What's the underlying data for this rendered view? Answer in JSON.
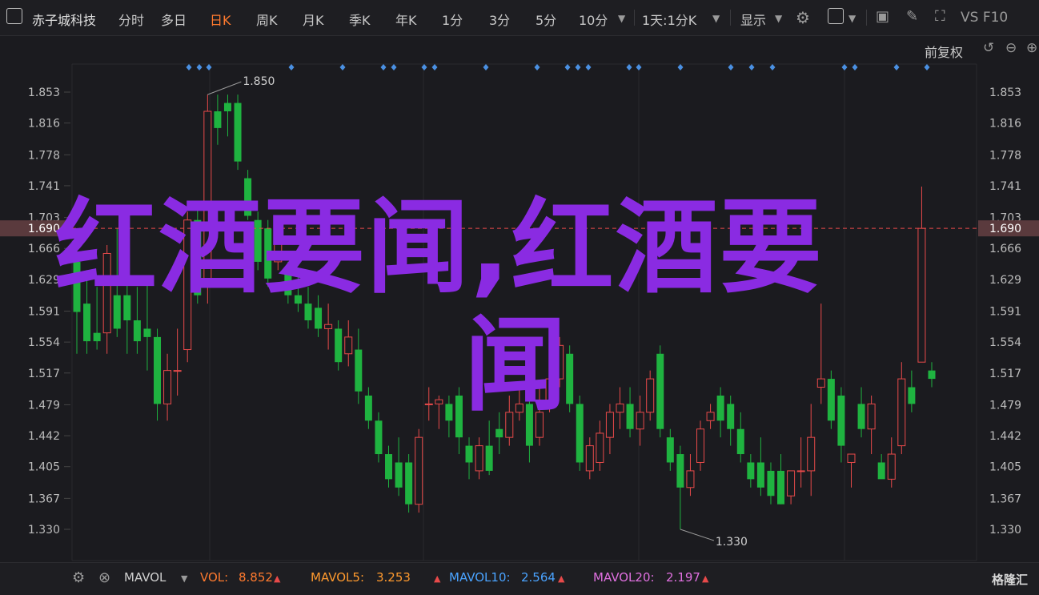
{
  "toolbar": {
    "stock_name": "赤子城科技",
    "periods": [
      "分时",
      "多日",
      "日K",
      "周K",
      "月K",
      "季K",
      "年K",
      "1分",
      "3分",
      "5分",
      "10分"
    ],
    "active_period": "日K",
    "range": "1天:1分K",
    "display": "显示",
    "vs_label": "VS F10"
  },
  "subbar": {
    "adjust": "前复权"
  },
  "watermark": {
    "line1": "红酒要闻,红酒要",
    "line2": "闻"
  },
  "colors": {
    "up": "#e84a4a",
    "down": "#1fb340",
    "watermark": "#8a2be2",
    "marker": "#4a90e2",
    "bg": "#1b1b1f"
  },
  "chart_data": {
    "type": "candlestick",
    "y_ticks": [
      "1.853",
      "1.816",
      "1.778",
      "1.741",
      "1.703",
      "1.666",
      "1.629",
      "1.591",
      "1.554",
      "1.517",
      "1.479",
      "1.442",
      "1.405",
      "1.367",
      "1.330"
    ],
    "ylim": [
      1.33,
      1.853
    ],
    "current_price": "1.690",
    "high_annotation": "1.850",
    "low_annotation": "1.330",
    "candles": [
      {
        "o": 1.65,
        "h": 1.68,
        "l": 1.54,
        "c": 1.59
      },
      {
        "o": 1.6,
        "h": 1.64,
        "l": 1.54,
        "c": 1.555
      },
      {
        "o": 1.565,
        "h": 1.62,
        "l": 1.545,
        "c": 1.555
      },
      {
        "o": 1.565,
        "h": 1.67,
        "l": 1.54,
        "c": 1.66
      },
      {
        "o": 1.61,
        "h": 1.69,
        "l": 1.56,
        "c": 1.57
      },
      {
        "o": 1.61,
        "h": 1.65,
        "l": 1.54,
        "c": 1.58
      },
      {
        "o": 1.58,
        "h": 1.62,
        "l": 1.54,
        "c": 1.555
      },
      {
        "o": 1.57,
        "h": 1.63,
        "l": 1.52,
        "c": 1.56
      },
      {
        "o": 1.56,
        "h": 1.57,
        "l": 1.46,
        "c": 1.48
      },
      {
        "o": 1.48,
        "h": 1.54,
        "l": 1.46,
        "c": 1.52
      },
      {
        "o": 1.52,
        "h": 1.57,
        "l": 1.49,
        "c": 1.52
      },
      {
        "o": 1.545,
        "h": 1.71,
        "l": 1.53,
        "c": 1.7
      },
      {
        "o": 1.7,
        "h": 1.72,
        "l": 1.6,
        "c": 1.61
      },
      {
        "o": 1.63,
        "h": 1.85,
        "l": 1.6,
        "c": 1.83
      },
      {
        "o": 1.83,
        "h": 1.85,
        "l": 1.79,
        "c": 1.81
      },
      {
        "o": 1.84,
        "h": 1.85,
        "l": 1.8,
        "c": 1.83
      },
      {
        "o": 1.84,
        "h": 1.85,
        "l": 1.76,
        "c": 1.77
      },
      {
        "o": 1.75,
        "h": 1.76,
        "l": 1.7,
        "c": 1.705
      },
      {
        "o": 1.7,
        "h": 1.71,
        "l": 1.64,
        "c": 1.65
      },
      {
        "o": 1.69,
        "h": 1.7,
        "l": 1.62,
        "c": 1.63
      },
      {
        "o": 1.65,
        "h": 1.7,
        "l": 1.64,
        "c": 1.69
      },
      {
        "o": 1.64,
        "h": 1.65,
        "l": 1.6,
        "c": 1.61
      },
      {
        "o": 1.61,
        "h": 1.64,
        "l": 1.59,
        "c": 1.6
      },
      {
        "o": 1.6,
        "h": 1.62,
        "l": 1.57,
        "c": 1.58
      },
      {
        "o": 1.595,
        "h": 1.61,
        "l": 1.56,
        "c": 1.57
      },
      {
        "o": 1.57,
        "h": 1.6,
        "l": 1.545,
        "c": 1.575
      },
      {
        "o": 1.57,
        "h": 1.58,
        "l": 1.52,
        "c": 1.53
      },
      {
        "o": 1.54,
        "h": 1.58,
        "l": 1.525,
        "c": 1.56
      },
      {
        "o": 1.545,
        "h": 1.57,
        "l": 1.48,
        "c": 1.495
      },
      {
        "o": 1.49,
        "h": 1.5,
        "l": 1.45,
        "c": 1.46
      },
      {
        "o": 1.46,
        "h": 1.47,
        "l": 1.41,
        "c": 1.42
      },
      {
        "o": 1.42,
        "h": 1.43,
        "l": 1.38,
        "c": 1.39
      },
      {
        "o": 1.41,
        "h": 1.44,
        "l": 1.37,
        "c": 1.38
      },
      {
        "o": 1.41,
        "h": 1.42,
        "l": 1.35,
        "c": 1.36
      },
      {
        "o": 1.36,
        "h": 1.45,
        "l": 1.35,
        "c": 1.44
      },
      {
        "o": 1.48,
        "h": 1.5,
        "l": 1.46,
        "c": 1.48
      },
      {
        "o": 1.48,
        "h": 1.49,
        "l": 1.45,
        "c": 1.485
      },
      {
        "o": 1.48,
        "h": 1.49,
        "l": 1.44,
        "c": 1.46
      },
      {
        "o": 1.49,
        "h": 1.5,
        "l": 1.42,
        "c": 1.44
      },
      {
        "o": 1.43,
        "h": 1.44,
        "l": 1.39,
        "c": 1.41
      },
      {
        "o": 1.4,
        "h": 1.44,
        "l": 1.39,
        "c": 1.43
      },
      {
        "o": 1.43,
        "h": 1.46,
        "l": 1.395,
        "c": 1.4
      },
      {
        "o": 1.45,
        "h": 1.47,
        "l": 1.42,
        "c": 1.44
      },
      {
        "o": 1.44,
        "h": 1.49,
        "l": 1.43,
        "c": 1.47
      },
      {
        "o": 1.47,
        "h": 1.5,
        "l": 1.46,
        "c": 1.48
      },
      {
        "o": 1.48,
        "h": 1.5,
        "l": 1.41,
        "c": 1.43
      },
      {
        "o": 1.44,
        "h": 1.5,
        "l": 1.43,
        "c": 1.47
      },
      {
        "o": 1.48,
        "h": 1.54,
        "l": 1.47,
        "c": 1.51
      },
      {
        "o": 1.51,
        "h": 1.56,
        "l": 1.5,
        "c": 1.55
      },
      {
        "o": 1.54,
        "h": 1.55,
        "l": 1.47,
        "c": 1.48
      },
      {
        "o": 1.48,
        "h": 1.49,
        "l": 1.4,
        "c": 1.41
      },
      {
        "o": 1.4,
        "h": 1.44,
        "l": 1.39,
        "c": 1.43
      },
      {
        "o": 1.41,
        "h": 1.46,
        "l": 1.4,
        "c": 1.445
      },
      {
        "o": 1.44,
        "h": 1.48,
        "l": 1.42,
        "c": 1.47
      },
      {
        "o": 1.47,
        "h": 1.5,
        "l": 1.45,
        "c": 1.48
      },
      {
        "o": 1.48,
        "h": 1.5,
        "l": 1.44,
        "c": 1.45
      },
      {
        "o": 1.45,
        "h": 1.49,
        "l": 1.43,
        "c": 1.47
      },
      {
        "o": 1.47,
        "h": 1.52,
        "l": 1.46,
        "c": 1.51
      },
      {
        "o": 1.54,
        "h": 1.55,
        "l": 1.44,
        "c": 1.45
      },
      {
        "o": 1.44,
        "h": 1.45,
        "l": 1.4,
        "c": 1.41
      },
      {
        "o": 1.42,
        "h": 1.43,
        "l": 1.33,
        "c": 1.38
      },
      {
        "o": 1.38,
        "h": 1.42,
        "l": 1.37,
        "c": 1.4
      },
      {
        "o": 1.41,
        "h": 1.46,
        "l": 1.4,
        "c": 1.45
      },
      {
        "o": 1.46,
        "h": 1.48,
        "l": 1.45,
        "c": 1.47
      },
      {
        "o": 1.49,
        "h": 1.5,
        "l": 1.44,
        "c": 1.46
      },
      {
        "o": 1.48,
        "h": 1.49,
        "l": 1.43,
        "c": 1.45
      },
      {
        "o": 1.45,
        "h": 1.47,
        "l": 1.41,
        "c": 1.42
      },
      {
        "o": 1.41,
        "h": 1.42,
        "l": 1.38,
        "c": 1.39
      },
      {
        "o": 1.41,
        "h": 1.44,
        "l": 1.37,
        "c": 1.38
      },
      {
        "o": 1.4,
        "h": 1.41,
        "l": 1.36,
        "c": 1.37
      },
      {
        "o": 1.4,
        "h": 1.42,
        "l": 1.36,
        "c": 1.36
      },
      {
        "o": 1.37,
        "h": 1.4,
        "l": 1.36,
        "c": 1.4
      },
      {
        "o": 1.4,
        "h": 1.44,
        "l": 1.38,
        "c": 1.4
      },
      {
        "o": 1.4,
        "h": 1.48,
        "l": 1.37,
        "c": 1.44
      },
      {
        "o": 1.5,
        "h": 1.6,
        "l": 1.48,
        "c": 1.51
      },
      {
        "o": 1.51,
        "h": 1.52,
        "l": 1.45,
        "c": 1.46
      },
      {
        "o": 1.49,
        "h": 1.5,
        "l": 1.41,
        "c": 1.43
      },
      {
        "o": 1.41,
        "h": 1.42,
        "l": 1.38,
        "c": 1.42
      },
      {
        "o": 1.48,
        "h": 1.5,
        "l": 1.44,
        "c": 1.45
      },
      {
        "o": 1.45,
        "h": 1.49,
        "l": 1.42,
        "c": 1.48
      },
      {
        "o": 1.41,
        "h": 1.42,
        "l": 1.4,
        "c": 1.39
      },
      {
        "o": 1.39,
        "h": 1.44,
        "l": 1.38,
        "c": 1.42
      },
      {
        "o": 1.43,
        "h": 1.53,
        "l": 1.42,
        "c": 1.51
      },
      {
        "o": 1.5,
        "h": 1.52,
        "l": 1.47,
        "c": 1.48
      },
      {
        "o": 1.53,
        "h": 1.74,
        "l": 1.53,
        "c": 1.69
      },
      {
        "o": 1.52,
        "h": 1.53,
        "l": 1.5,
        "c": 1.51
      }
    ]
  },
  "markers": [
    236,
    249,
    261,
    364,
    428,
    479,
    492,
    530,
    543,
    607,
    671,
    709,
    722,
    735,
    786,
    798,
    850,
    913,
    939,
    965,
    1055,
    1068,
    1120,
    1158
  ],
  "volume_bar": {
    "indicator": "MAVOL",
    "vol_label": "VOL:",
    "vol_value": "8.852",
    "mavol5_label": "MAVOL5:",
    "mavol5_value": "3.253",
    "mavol10_label": "MAVOL10:",
    "mavol10_value": "2.564",
    "mavol20_label": "MAVOL20:",
    "mavol20_value": "2.197",
    "logo": "格隆汇"
  }
}
